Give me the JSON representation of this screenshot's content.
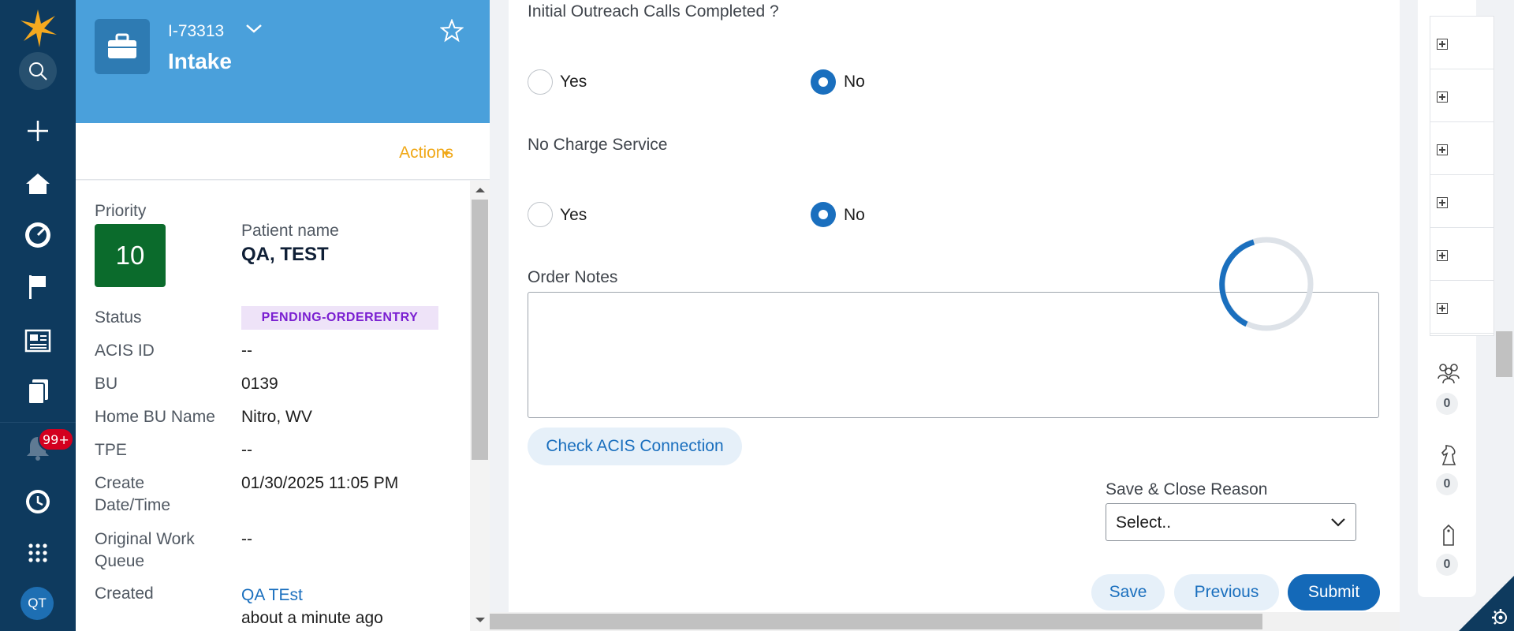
{
  "nav": {
    "items": [
      "logo",
      "search",
      "create",
      "home",
      "dashboard",
      "flag",
      "news",
      "documents",
      "notifications",
      "history",
      "apps"
    ],
    "notification_count": "99+",
    "user_initials": "QT"
  },
  "case": {
    "id": "I-73313",
    "title": "Intake",
    "actions_label": "Actions"
  },
  "details": {
    "priority_label": "Priority",
    "priority_value": "10",
    "patient_name_label": "Patient name",
    "patient_name": "QA, TEST",
    "fields": [
      {
        "label": "Status",
        "value": "PENDING-ORDERENTRY"
      },
      {
        "label": "ACIS ID",
        "value": "--"
      },
      {
        "label": "BU",
        "value": "0139"
      },
      {
        "label": "Home BU Name",
        "value": "Nitro, WV"
      },
      {
        "label": "TPE",
        "value": "--"
      },
      {
        "label": "Create Date/Time",
        "value": "01/30/2025 11:05 PM"
      },
      {
        "label": "Original Work Queue",
        "value": "--"
      },
      {
        "label": "Created",
        "value": "QA TEst",
        "subvalue": "about a minute ago"
      }
    ]
  },
  "form": {
    "q1": {
      "label": "Initial Outreach Calls Completed ?",
      "yes": "Yes",
      "no": "No",
      "selected": "No"
    },
    "q2": {
      "label": "No Charge Service",
      "yes": "Yes",
      "no": "No",
      "selected": "No"
    },
    "order_notes_label": "Order Notes",
    "order_notes_value": "",
    "check_button": "Check ACIS Connection",
    "save_close_reason_label": "Save & Close Reason",
    "save_close_reason_value": "Select..",
    "save_button": "Save",
    "previous_button": "Previous",
    "submit_button": "Submit"
  },
  "utility": {
    "counts": [
      "0",
      "0",
      "0"
    ]
  },
  "colors": {
    "nav_bg": "#0e3a5e",
    "header_bg": "#4aa0db",
    "priority_bg": "#0b6b2c",
    "accent_blue": "#1a6fbe",
    "actions_orange": "#f0a818",
    "status_purple": "#7a1fd1"
  }
}
